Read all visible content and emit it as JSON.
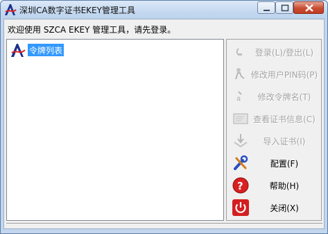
{
  "window": {
    "title": "深圳CA数字证书EKEY管理工具"
  },
  "welcome_text": "欢迎使用 SZCA EKEY 管理工具，请先登录。",
  "tree": {
    "root_label": "令牌列表"
  },
  "actions": [
    {
      "label": "登录(L)/登出(L)",
      "enabled": false,
      "icon": "login-icon"
    },
    {
      "label": "修改用户PIN码(P)",
      "enabled": false,
      "icon": "user-pin-icon"
    },
    {
      "label": "修改令牌名(T)",
      "enabled": false,
      "icon": "rename-icon"
    },
    {
      "label": "查看证书信息(C)",
      "enabled": false,
      "icon": "certificate-icon"
    },
    {
      "label": "导入证书(I)",
      "enabled": false,
      "icon": "import-icon"
    },
    {
      "label": "配置(F)",
      "enabled": true,
      "icon": "tools-icon"
    },
    {
      "label": "帮助(H)",
      "enabled": true,
      "icon": "help-icon"
    },
    {
      "label": "关闭(X)",
      "enabled": true,
      "icon": "power-icon"
    }
  ],
  "colors": {
    "selection": "#3399ff",
    "disabled_text": "#a5a5a5",
    "close_button": "#c84d32"
  }
}
